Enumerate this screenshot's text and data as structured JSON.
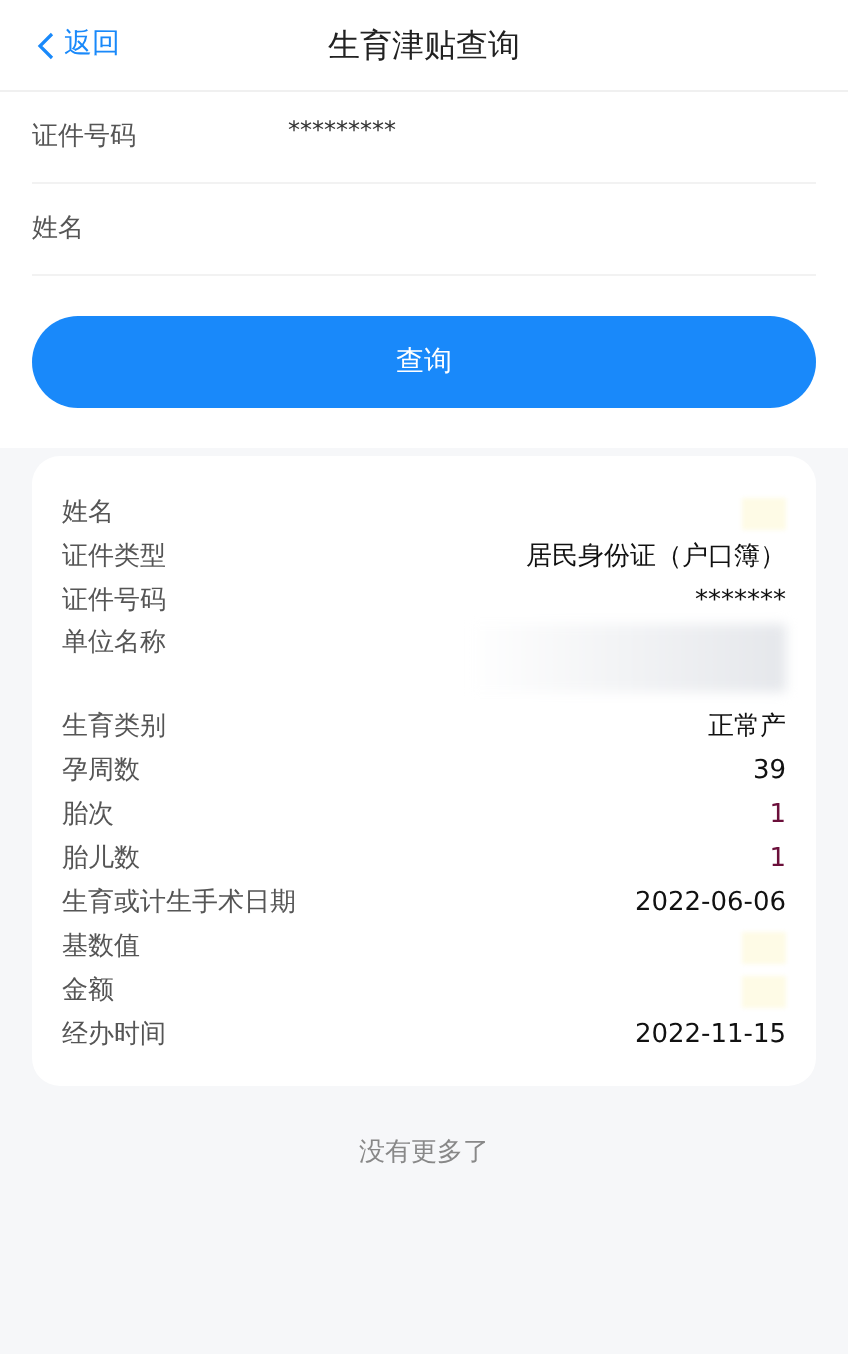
{
  "header": {
    "back": "返回",
    "title": "生育津贴查询"
  },
  "form": [
    {
      "label": "证件号码",
      "value": "*********"
    },
    {
      "label": "姓名"
    }
  ],
  "query_button": "查询",
  "result": [
    {
      "label": "姓名",
      "kind": "redacted"
    },
    {
      "label": "证件类型",
      "kind": "plain",
      "value": "居民身份证（户口簿）"
    },
    {
      "label": "证件号码",
      "kind": "plain",
      "value": "*******"
    },
    {
      "label": "单位名称",
      "kind": "redacted_long"
    },
    {
      "label": "生育类别",
      "kind": "plain",
      "value": "正常产"
    },
    {
      "label": "孕周数",
      "kind": "plain",
      "value": "39"
    },
    {
      "label": "胎次",
      "kind": "highlight",
      "value": "1"
    },
    {
      "label": "胎儿数",
      "kind": "highlight",
      "value": "1"
    },
    {
      "label": "生育或计生手术日期",
      "kind": "plain",
      "value": "2022-06-06"
    },
    {
      "label": "基数值",
      "kind": "redacted"
    },
    {
      "label": "金额",
      "kind": "redacted"
    },
    {
      "label": "经办时间",
      "kind": "plain",
      "value": "2022-11-15"
    }
  ],
  "footer": "没有更多了"
}
